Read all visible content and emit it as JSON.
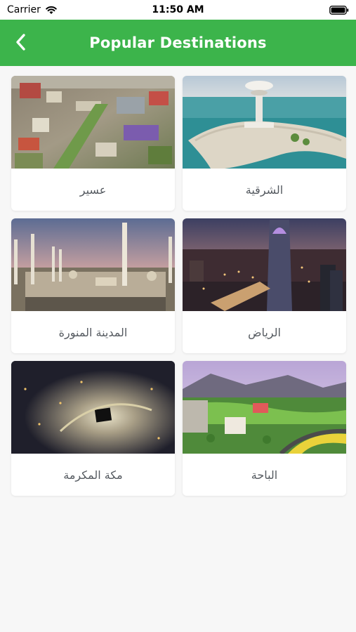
{
  "status_bar": {
    "carrier": "Carrier",
    "time": "11:50 AM"
  },
  "nav": {
    "title": "Popular Destinations",
    "back_icon": "chevron-left-icon"
  },
  "colors": {
    "accent": "#3cb44b",
    "background": "#f7f7f7",
    "card": "#ffffff",
    "label_text": "#555a60"
  },
  "destinations": [
    {
      "label": "عسير"
    },
    {
      "label": "الشرقية"
    },
    {
      "label": "المدينة المنورة"
    },
    {
      "label": "الرياض"
    },
    {
      "label": "مكة المكرمة"
    },
    {
      "label": "الباحة"
    }
  ]
}
